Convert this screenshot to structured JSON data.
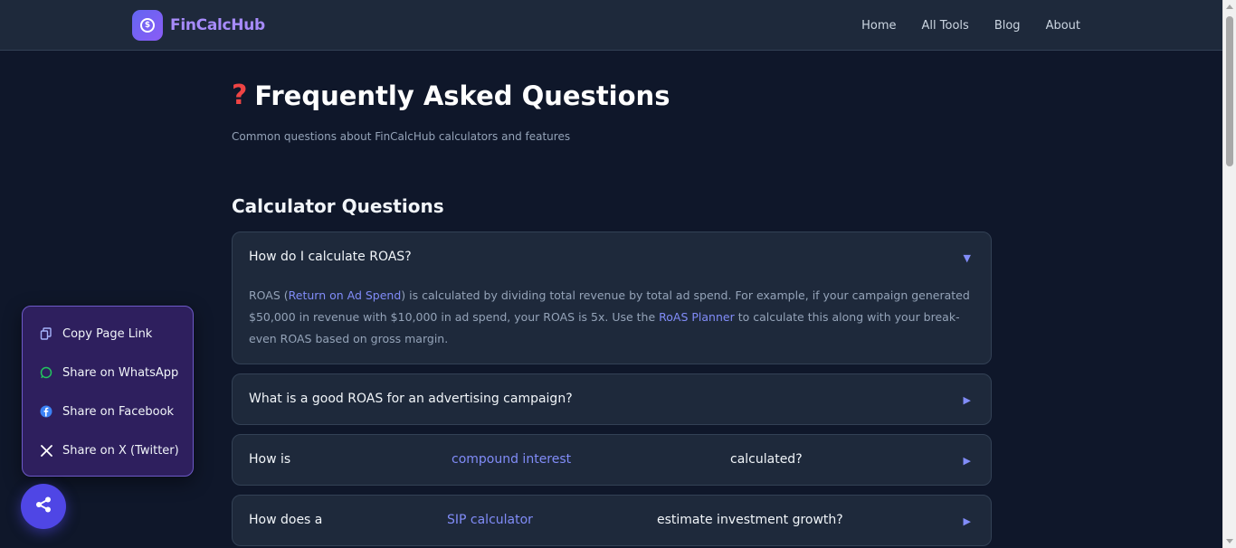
{
  "brand": {
    "name": "FinCalcHub",
    "icon": "dollar-coin-icon"
  },
  "nav": {
    "home": "Home",
    "tools": "All Tools",
    "blog": "Blog",
    "about": "About"
  },
  "page": {
    "title": "Frequently Asked Questions",
    "subtitle": "Common questions about FinCalcHub calculators and features",
    "section": "Calculator Questions"
  },
  "faq": [
    {
      "question": "How do I calculate ROAS?",
      "expanded": true,
      "answer": {
        "p1": "ROAS (",
        "link1": "Return on Ad Spend",
        "p2": ") is calculated by dividing total revenue by total ad spend. For example, if your campaign generated $50,000 in revenue with $10,000 in ad spend, your ROAS is 5x. Use the ",
        "link2": "RoAS Planner",
        "p3": " to calculate this along with your break-even ROAS based on gross margin."
      }
    },
    {
      "question": "What is a good ROAS for an advertising campaign?",
      "expanded": false
    },
    {
      "q_before": "How is",
      "q_link": "compound interest",
      "q_after": "calculated?",
      "expanded": false
    },
    {
      "q_before": "How does a",
      "q_link": "SIP calculator",
      "q_after": "estimate investment growth?",
      "expanded": false
    }
  ],
  "share": {
    "copy": "Copy Page Link",
    "whatsapp": "Share on WhatsApp",
    "facebook": "Share on Facebook",
    "x": "Share on X (Twitter)"
  },
  "colors": {
    "bg": "#0f172a",
    "card": "#1e293b",
    "accent": "#818cf8",
    "share_bg": "#2e1f5e"
  }
}
